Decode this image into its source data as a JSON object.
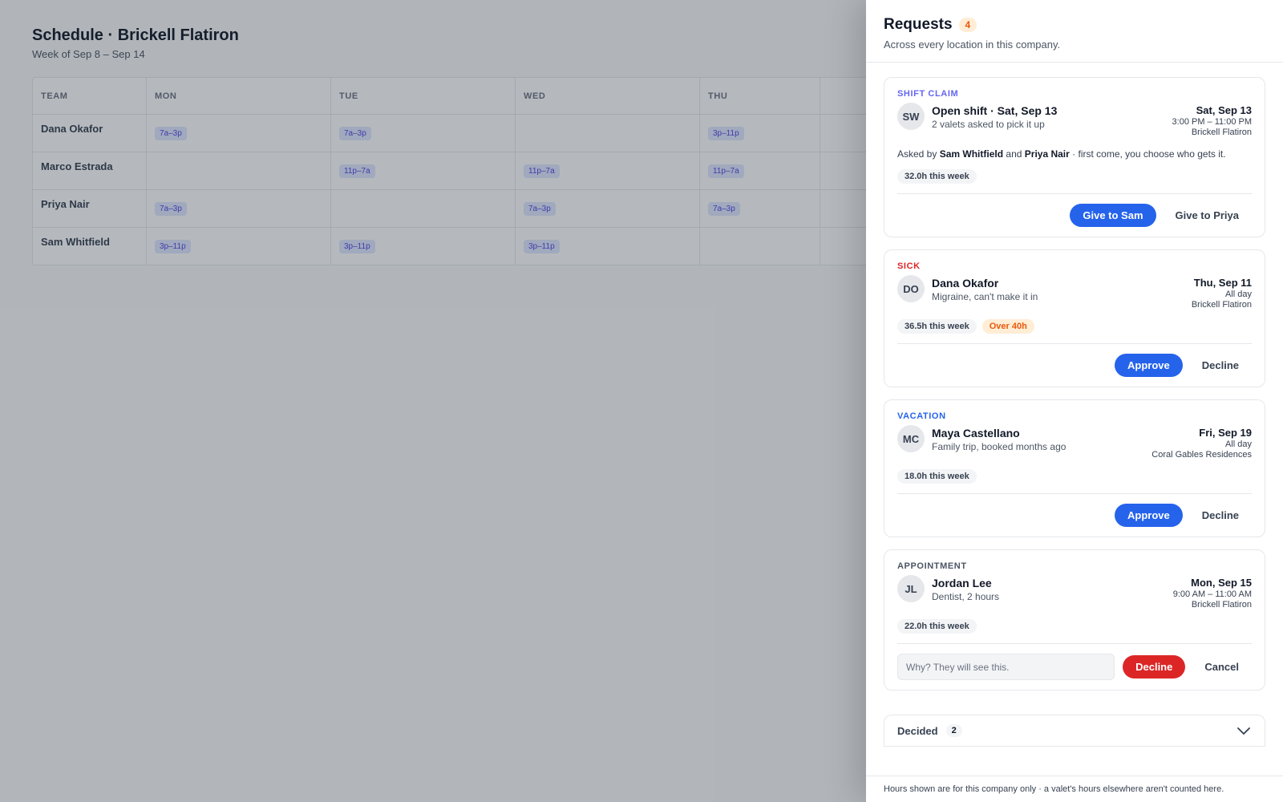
{
  "page": {
    "title": "Schedule · Brickell Flatiron",
    "subtitle": "Week of Sep 8 – Sep 14"
  },
  "schedule": {
    "columns": [
      "TEAM",
      "MON",
      "TUE",
      "WED",
      "THU",
      ""
    ],
    "rows": [
      {
        "name": "Dana Okafor",
        "shifts": [
          "7a–3p",
          "7a–3p",
          "",
          "3p–11p",
          ""
        ]
      },
      {
        "name": "Marco Estrada",
        "shifts": [
          "",
          "11p–7a",
          "11p–7a",
          "11p–7a",
          ""
        ]
      },
      {
        "name": "Priya Nair",
        "shifts": [
          "7a–3p",
          "",
          "7a–3p",
          "7a–3p",
          ""
        ]
      },
      {
        "name": "Sam Whitfield",
        "shifts": [
          "3p–11p",
          "3p–11p",
          "3p–11p",
          "",
          ""
        ]
      }
    ]
  },
  "drawer": {
    "title": "Requests",
    "count": "4",
    "subtitle": "Across every location in this company."
  },
  "requests": [
    {
      "kind": "SHIFT CLAIM",
      "kind_color": "#6366f1",
      "initials": "SW",
      "name": "Open shift · Sat, Sep 13",
      "detail": "2 valets asked to pick it up",
      "date": "Sat, Sep 13",
      "time": "3:00 PM – 11:00 PM",
      "location": "Brickell Flatiron",
      "asked_prefix": "Asked by",
      "asked_a": "Sam Whitfield",
      "asked_and": "and",
      "asked_b": "Priya Nair",
      "asked_suffix": "· first come, you choose who gets it.",
      "hours": "32.0h this week",
      "primary": "Give to Sam",
      "secondary": "Give to Priya"
    },
    {
      "kind": "SICK",
      "kind_color": "#dc2626",
      "initials": "DO",
      "name": "Dana Okafor",
      "detail": "Migraine, can't make it in",
      "date": "Thu, Sep 11",
      "time": "All day",
      "location": "Brickell Flatiron",
      "hours": "36.5h this week",
      "warning": "Over 40h",
      "primary": "Approve",
      "secondary": "Decline"
    },
    {
      "kind": "VACATION",
      "kind_color": "#2563eb",
      "initials": "MC",
      "name": "Maya Castellano",
      "detail": "Family trip, booked months ago",
      "date": "Fri, Sep 19",
      "time": "All day",
      "location": "Coral Gables Residences",
      "hours": "18.0h this week",
      "primary": "Approve",
      "secondary": "Decline"
    },
    {
      "kind": "APPOINTMENT",
      "kind_color": "#4b5563",
      "initials": "JL",
      "name": "Jordan Lee",
      "detail": "Dentist, 2 hours",
      "date": "Mon, Sep 15",
      "time": "9:00 AM – 11:00 AM",
      "location": "Brickell Flatiron",
      "hours": "22.0h this week",
      "reason_placeholder": "Why? They will see this.",
      "primary": "Decline",
      "secondary": "Cancel"
    }
  ],
  "decided": {
    "label": "Decided",
    "count": "2",
    "icon": "chevron-down-icon"
  },
  "footer_note": "Hours shown are for this company only · a valet's hours elsewhere aren't counted here."
}
